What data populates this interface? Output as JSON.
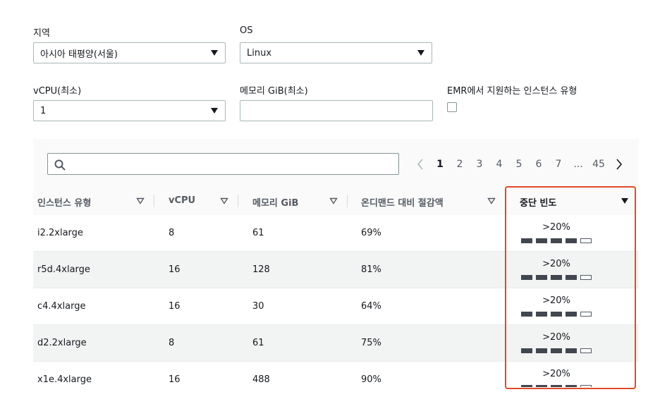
{
  "filters": {
    "region": {
      "label": "지역",
      "value": "아시아 태평양(서울)"
    },
    "os": {
      "label": "OS",
      "value": "Linux"
    },
    "vcpu": {
      "label": "vCPU(최소)",
      "value": "1"
    },
    "memory": {
      "label": "메모리 GiB(최소)",
      "value": "",
      "placeholder": ""
    },
    "emr": {
      "label": "EMR에서 지원하는 인스턴스 유형",
      "checked": false
    }
  },
  "search": {
    "placeholder": ""
  },
  "pagination": {
    "pages": [
      "1",
      "2",
      "3",
      "4",
      "5",
      "6",
      "7",
      "...",
      "45"
    ],
    "current": "1"
  },
  "table": {
    "columns": [
      "인스턴스 유형",
      "vCPU",
      "메모리 GiB",
      "온디맨드 대비 절감액",
      "중단 빈도"
    ],
    "rows": [
      {
        "type": "i2.2xlarge",
        "vcpu": "8",
        "memory": "61",
        "savings": "69%",
        "interruption": ">20%",
        "level": 4
      },
      {
        "type": "r5d.4xlarge",
        "vcpu": "16",
        "memory": "128",
        "savings": "81%",
        "interruption": ">20%",
        "level": 4
      },
      {
        "type": "c4.4xlarge",
        "vcpu": "16",
        "memory": "30",
        "savings": "64%",
        "interruption": ">20%",
        "level": 4
      },
      {
        "type": "d2.2xlarge",
        "vcpu": "8",
        "memory": "61",
        "savings": "75%",
        "interruption": ">20%",
        "level": 4
      },
      {
        "type": "x1e.4xlarge",
        "vcpu": "16",
        "memory": "488",
        "savings": "90%",
        "interruption": ">20%",
        "level": 4
      }
    ]
  },
  "colors": {
    "highlight": "#dd4b2a",
    "bar_filled": "#414750"
  }
}
